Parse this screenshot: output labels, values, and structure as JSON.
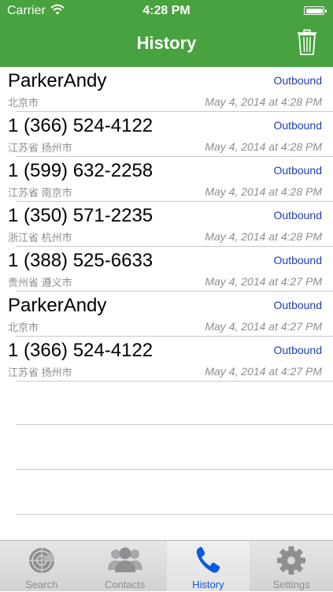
{
  "status_bar": {
    "carrier": "Carrier",
    "time": "4:28 PM"
  },
  "nav": {
    "title": "History",
    "trash_icon": "trash-icon"
  },
  "history": [
    {
      "name": "ParkerAndy",
      "location": "北京市",
      "direction": "Outbound",
      "datetime": "May 4, 2014 at 4:28 PM"
    },
    {
      "name": "1 (366) 524-4122",
      "location": "江苏省 扬州市",
      "direction": "Outbound",
      "datetime": "May 4, 2014 at 4:28 PM"
    },
    {
      "name": "1 (599) 632-2258",
      "location": "江苏省 南京市",
      "direction": "Outbound",
      "datetime": "May 4, 2014 at 4:28 PM"
    },
    {
      "name": "1 (350) 571-2235",
      "location": "浙江省 杭州市",
      "direction": "Outbound",
      "datetime": "May 4, 2014 at 4:28 PM"
    },
    {
      "name": "1 (388) 525-6633",
      "location": "贵州省 遵义市",
      "direction": "Outbound",
      "datetime": "May 4, 2014 at 4:27 PM"
    },
    {
      "name": "ParkerAndy",
      "location": "北京市",
      "direction": "Outbound",
      "datetime": "May 4, 2014 at 4:27 PM"
    },
    {
      "name": "1 (366) 524-4122",
      "location": "江苏省 扬州市",
      "direction": "Outbound",
      "datetime": "May 4, 2014 at 4:27 PM"
    }
  ],
  "tabs": [
    {
      "label": "Search",
      "icon": "radar-icon",
      "active": false
    },
    {
      "label": "Contacts",
      "icon": "contacts-icon",
      "active": false
    },
    {
      "label": "History",
      "icon": "phone-icon",
      "active": true
    },
    {
      "label": "Settings",
      "icon": "gear-icon",
      "active": false
    }
  ],
  "colors": {
    "header": "#47a23f",
    "direction_text": "#1f3fb0",
    "active_tab": "#0a5be0"
  }
}
